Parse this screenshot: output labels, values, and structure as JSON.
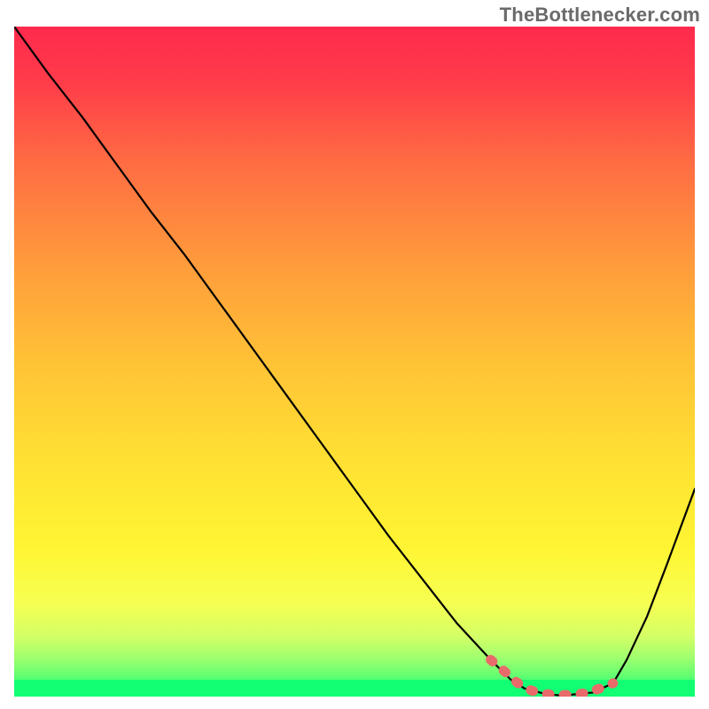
{
  "watermark": "TheBottlenecker.com",
  "chart_data": {
    "type": "line",
    "title": "",
    "xlabel": "",
    "ylabel": "",
    "xlim": [
      0,
      100
    ],
    "ylim": [
      0,
      100
    ],
    "gradient_background": {
      "top_color": "#ff2a4d",
      "mid_color": "#ffd333",
      "bottom_color": "#12ff74"
    },
    "green_band": {
      "y_start": 94,
      "y_end": 100
    },
    "uniform_bottom_band": {
      "y_start": 97.5,
      "y_end": 100,
      "color": "#12ff74"
    },
    "curve": {
      "description": "V-shaped bottleneck curve descending from top-left to a minimum near x≈80 then rising",
      "x": [
        0,
        5,
        10,
        15,
        20,
        25,
        30,
        35,
        40,
        45,
        50,
        55,
        60,
        65,
        70,
        73,
        75,
        78,
        80,
        82,
        85,
        88,
        90,
        93,
        96,
        100
      ],
      "y": [
        100,
        93,
        86.5,
        79.5,
        72.5,
        66,
        59,
        52,
        45,
        38,
        31,
        24,
        17.5,
        11,
        5.5,
        2.5,
        1.2,
        0.4,
        0.2,
        0.3,
        0.6,
        2.0,
        5.5,
        12,
        20,
        31
      ]
    },
    "highlight_segment": {
      "description": "Thick dashed coral segment along the valley of the curve",
      "color": "#e96a6a",
      "x": [
        70,
        72,
        74,
        76,
        78,
        80,
        82,
        84,
        86,
        88
      ],
      "y": [
        5.5,
        3.8,
        2.0,
        0.9,
        0.4,
        0.2,
        0.3,
        0.5,
        1.2,
        2.0
      ]
    }
  }
}
